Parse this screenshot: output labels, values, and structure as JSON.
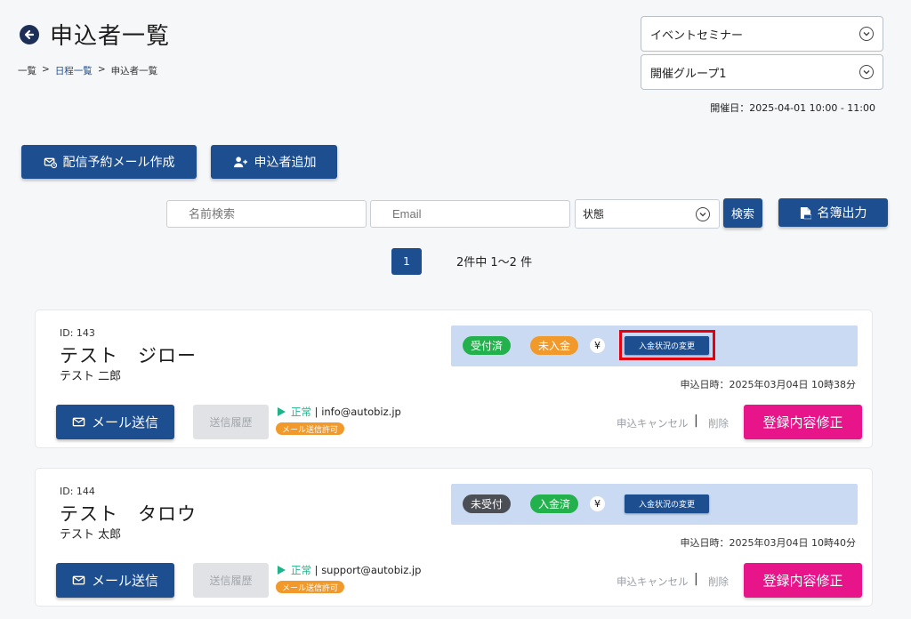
{
  "header": {
    "title": "申込者一覧",
    "back_icon": "arrow-left-circle-icon"
  },
  "breadcrumb": [
    "一覧",
    ">",
    "日程一覧",
    ">",
    "申込者一覧"
  ],
  "selects": {
    "event": "イベントセミナー",
    "group": "開催グループ1"
  },
  "event_date": "開催日：2025-04-01 10:00 - 11:00",
  "actions": {
    "scheduled_mail": "配信予約メール作成",
    "add_applicant": "申込者追加"
  },
  "search": {
    "name_placeholder": "名前検索",
    "email_placeholder": "Email",
    "state_label": "状態",
    "search_button": "検索",
    "export_button": "名簿出力"
  },
  "pagination": {
    "current_page": "1",
    "summary": "2件中 1〜2 件"
  },
  "applicants": [
    {
      "id_label": "ID:",
      "id": "143",
      "name": "テスト　ジロー",
      "name_kanji": "テスト 二郎",
      "reception_status": "受付済",
      "payment_status": "未入金",
      "yen": "¥",
      "payment_change_button": "入金状況の変更",
      "applied_at": "申込日時：2025年03月04日 10時38分",
      "mail_button": "メール送信",
      "history_button": "送信履歴",
      "mail_state": "正常",
      "email": "info@autobiz.jp",
      "mail_permission": "メール送信許可",
      "cancel_link": "申込キャンセル",
      "separator": "|",
      "delete_link": "削除",
      "edit_button": "登録内容修正"
    },
    {
      "id_label": "ID:",
      "id": "144",
      "name": "テスト　タロウ",
      "name_kanji": "テスト 太郎",
      "reception_status": "未受付",
      "payment_status": "入金済",
      "yen": "¥",
      "payment_change_button": "入金状況の変更",
      "applied_at": "申込日時：2025年03月04日 10時40分",
      "mail_button": "メール送信",
      "history_button": "送信履歴",
      "mail_state": "正常",
      "email": "support@autobiz.jp",
      "mail_permission": "メール送信許可",
      "cancel_link": "申込キャンセル",
      "separator": "|",
      "delete_link": "削除",
      "edit_button": "登録内容修正"
    }
  ],
  "colors": {
    "primary": "#1d4e8f",
    "accept_green": "#22b14c",
    "unpaid_orange": "#f19a2b",
    "unaccepted_gray": "#4b4f55",
    "edit_pink": "#e7148a",
    "highlight_red": "#e4000f",
    "status_bar_bg": "#c9daf2"
  }
}
